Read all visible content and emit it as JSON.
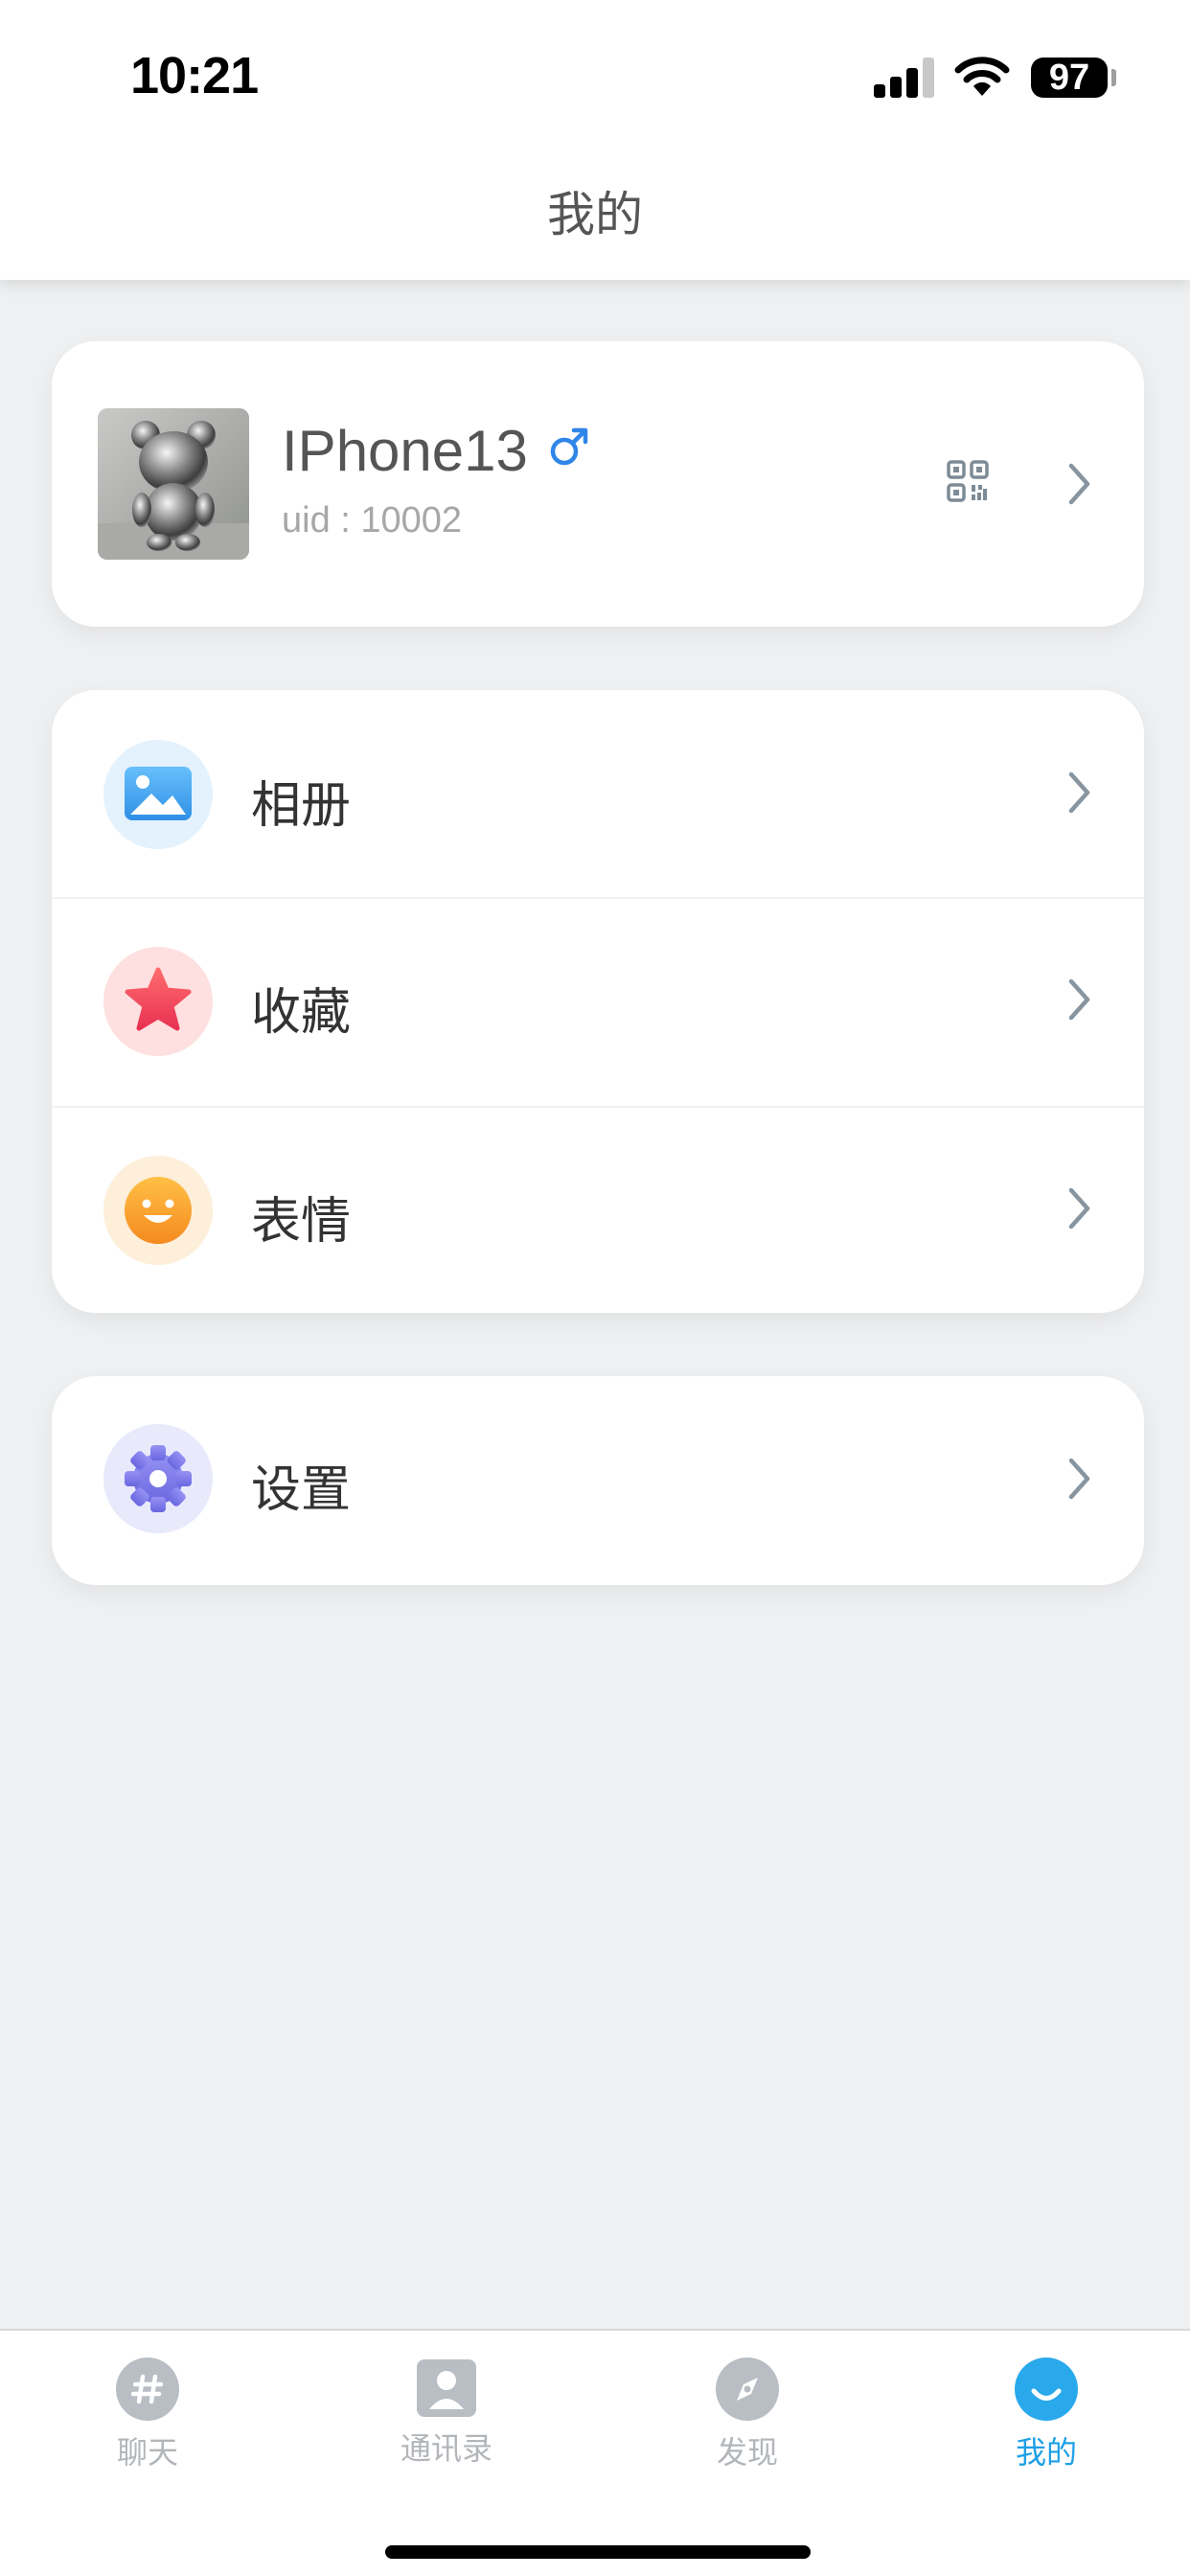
{
  "status_bar": {
    "time": "10:21",
    "battery": "97",
    "icons": [
      "cellular-signal-icon",
      "wifi-icon",
      "battery-icon"
    ]
  },
  "header": {
    "title": "我的"
  },
  "profile": {
    "name": "IPhone13",
    "uid": "uid : 10002",
    "gender_icon": "male-icon",
    "qr_icon": "qr-code-icon"
  },
  "menu": [
    {
      "label": "相册",
      "icon": "album-icon",
      "color": "#3e9ff0"
    },
    {
      "label": "收藏",
      "icon": "star-icon",
      "color": "#f0445c"
    },
    {
      "label": "表情",
      "icon": "smiley-icon",
      "color": "#f7a22e"
    }
  ],
  "settings": {
    "label": "设置",
    "icon": "gear-icon",
    "color": "#7a7be8"
  },
  "tabbar": {
    "tabs": [
      {
        "label": "聊天",
        "icon": "hash-chat-icon",
        "active": false
      },
      {
        "label": "通讯录",
        "icon": "contacts-icon",
        "active": false
      },
      {
        "label": "发现",
        "icon": "compass-icon",
        "active": false
      },
      {
        "label": "我的",
        "icon": "smile-icon",
        "active": true
      }
    ],
    "active_color": "#1ea0e6"
  }
}
